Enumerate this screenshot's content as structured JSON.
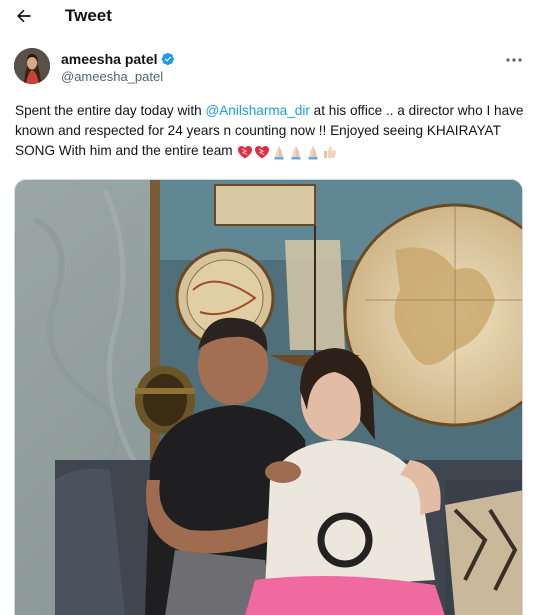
{
  "header": {
    "title": "Tweet",
    "back_icon": "arrow-left-icon"
  },
  "author": {
    "display_name": "ameesha patel",
    "handle": "@ameesha_patel",
    "verified_icon": "verified-badge-icon",
    "verified_color": "#1d9bf0"
  },
  "tweet": {
    "text_before": "Spent the entire day today with ",
    "mention": "@Anilsharma_dir",
    "text_after": " at his office .. a director who I have known and respected for 24 years n counting now !! Enjoyed seeing KHAIRAYAT SONG With him and the entire team",
    "emojis": [
      "heart-icon",
      "heart-icon",
      "folded-hands-icon",
      "folded-hands-icon",
      "folded-hands-icon",
      "thumbs-up-icon"
    ]
  },
  "colors": {
    "link": "#1d9bf0",
    "text": "#0f1419",
    "secondary_text": "#536471"
  }
}
